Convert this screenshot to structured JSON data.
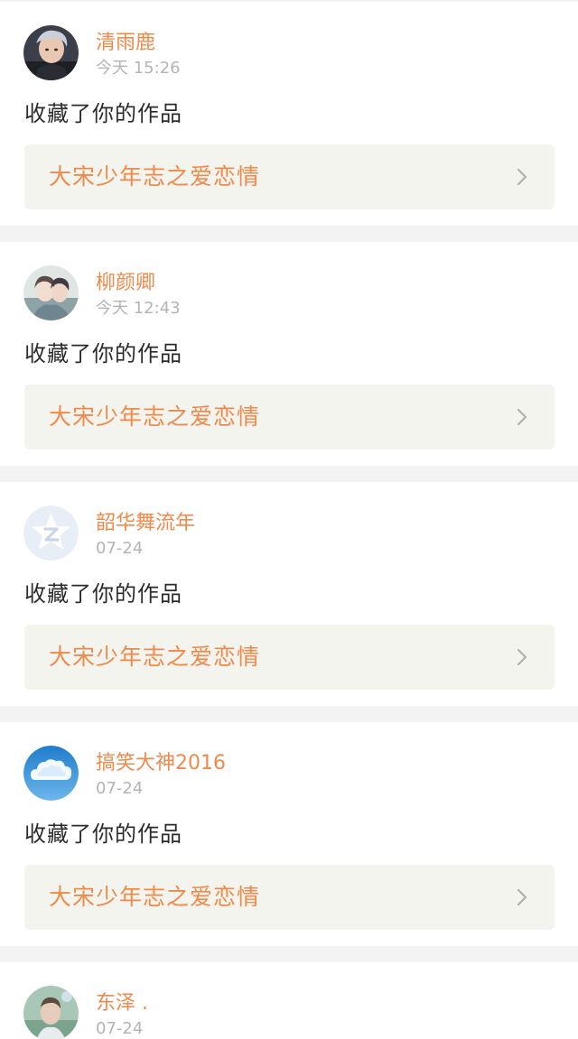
{
  "feed": {
    "items": [
      {
        "username": "清雨鹿",
        "time": "今天 15:26",
        "action": "收藏了你的作品",
        "work_title": "大宋少年志之爱恋情",
        "avatar_icon": "user-photo-icon"
      },
      {
        "username": "柳颜卿",
        "time": "今天 12:43",
        "action": "收藏了你的作品",
        "work_title": "大宋少年志之爱恋情",
        "avatar_icon": "user-photo-icon"
      },
      {
        "username": "韶华舞流年",
        "time": "07-24",
        "action": "收藏了你的作品",
        "work_title": "大宋少年志之爱恋情",
        "avatar_icon": "default-star-avatar-icon"
      },
      {
        "username": "搞笑大神2016",
        "time": "07-24",
        "action": "收藏了你的作品",
        "work_title": "大宋少年志之爱恋情",
        "avatar_icon": "cloud-avatar-icon"
      },
      {
        "username": "东泽 .",
        "time": "07-24",
        "avatar_icon": "user-photo-icon"
      }
    ]
  },
  "colors": {
    "accent": "#f08a4b",
    "muted": "#b4b4b4",
    "text": "#2b2b2b",
    "card": "#ffffff",
    "work_bg": "#f4f4ef",
    "page_bg": "#f3f3f3"
  }
}
